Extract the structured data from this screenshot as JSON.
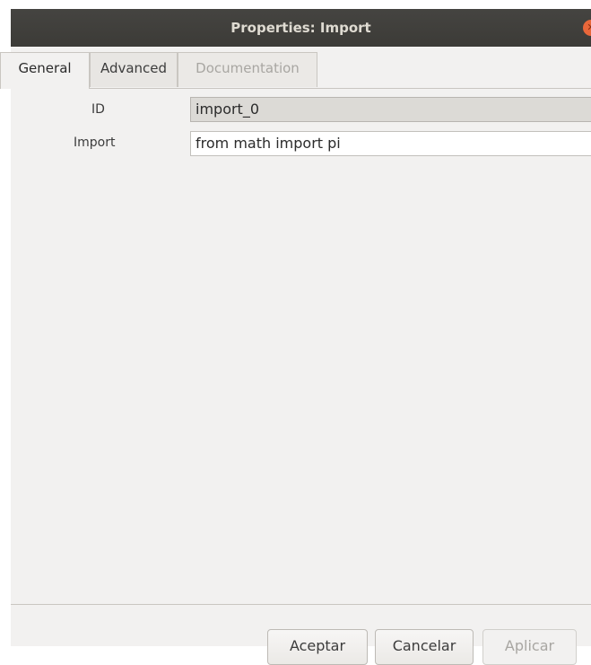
{
  "window": {
    "title": "Properties: Import",
    "close_icon": "close-icon"
  },
  "tabs": [
    {
      "label": "General",
      "state": "active"
    },
    {
      "label": "Advanced",
      "state": "normal"
    },
    {
      "label": "Documentation",
      "state": "disabled"
    }
  ],
  "fields": {
    "id": {
      "label": "ID",
      "value": "import_0"
    },
    "import": {
      "label": "Import",
      "value": "from math import pi"
    }
  },
  "buttons": {
    "accept": "Aceptar",
    "cancel": "Cancelar",
    "apply": "Aplicar"
  },
  "colors": {
    "titlebar": "#3c3b37",
    "close_button": "#e9673a",
    "window_bg": "#f2f1f0"
  }
}
